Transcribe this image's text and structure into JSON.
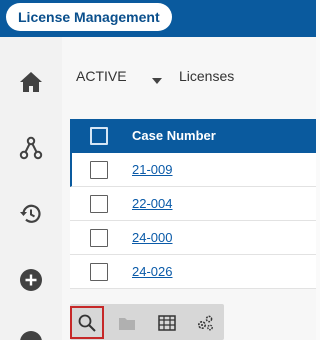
{
  "app": {
    "title": "License Management"
  },
  "sidebar": {
    "items": [
      {
        "icon": "home-icon"
      },
      {
        "icon": "workflow-icon"
      },
      {
        "icon": "history-icon"
      },
      {
        "icon": "add-circle-icon"
      },
      {
        "icon": "more-circle-icon"
      }
    ]
  },
  "filter": {
    "status": "ACTIVE",
    "type": "Licenses"
  },
  "table": {
    "header": "Case Number",
    "rows": [
      {
        "case_number": "21-009"
      },
      {
        "case_number": "22-004"
      },
      {
        "case_number": "24-000"
      },
      {
        "case_number": "24-026"
      }
    ]
  },
  "toolbar": {
    "tools": [
      "search-icon",
      "folder-icon",
      "table-icon",
      "settings-icon"
    ],
    "active": "search-icon"
  },
  "colors": {
    "brand": "#0a5a9e",
    "link": "#0a5aa8",
    "active_outline": "#c62828"
  }
}
